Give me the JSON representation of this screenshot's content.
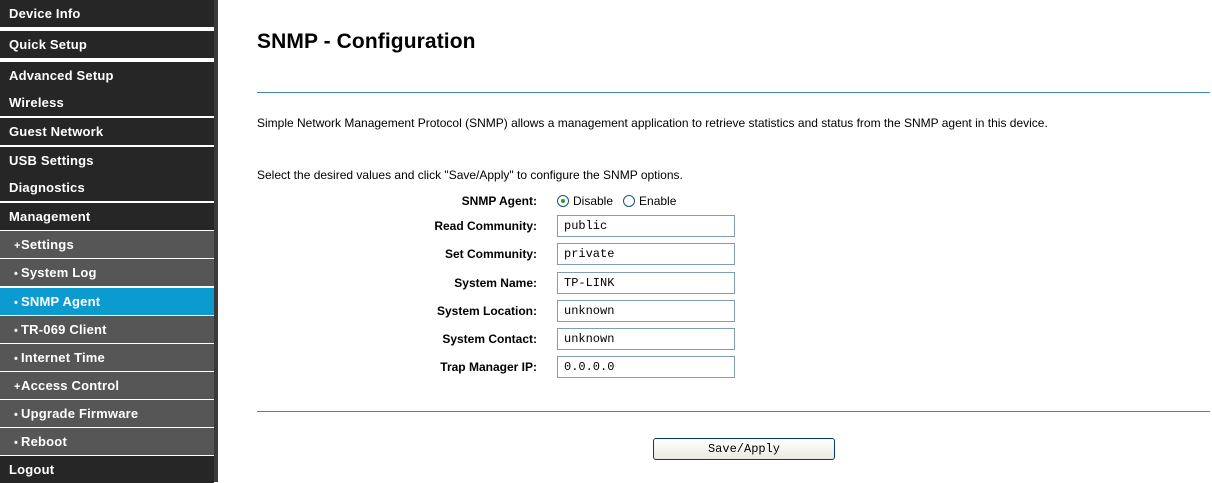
{
  "sidebar": {
    "items": [
      {
        "label": "Device Info",
        "prefix": "",
        "level": "top",
        "active": false
      },
      {
        "label": "Quick Setup",
        "prefix": "",
        "level": "top",
        "active": false
      },
      {
        "label": "Advanced Setup",
        "prefix": "",
        "level": "top",
        "active": false
      },
      {
        "label": "Wireless",
        "prefix": "",
        "level": "top",
        "active": false
      },
      {
        "label": "Guest Network",
        "prefix": "",
        "level": "top",
        "active": false
      },
      {
        "label": "USB Settings",
        "prefix": "",
        "level": "top",
        "active": false
      },
      {
        "label": "Diagnostics",
        "prefix": "",
        "level": "top",
        "active": false
      },
      {
        "label": "Management",
        "prefix": "",
        "level": "top",
        "active": false
      },
      {
        "label": "Settings",
        "prefix": "+",
        "level": "sub",
        "active": false
      },
      {
        "label": "System Log",
        "prefix": "•",
        "level": "sub",
        "active": false
      },
      {
        "label": "SNMP Agent",
        "prefix": "•",
        "level": "sub",
        "active": true
      },
      {
        "label": "TR-069 Client",
        "prefix": "•",
        "level": "sub",
        "active": false
      },
      {
        "label": "Internet Time",
        "prefix": "•",
        "level": "sub",
        "active": false
      },
      {
        "label": "Access Control",
        "prefix": "+",
        "level": "sub",
        "active": false
      },
      {
        "label": "Upgrade Firmware",
        "prefix": "•",
        "level": "sub",
        "active": false
      },
      {
        "label": "Reboot",
        "prefix": "•",
        "level": "sub",
        "active": false
      },
      {
        "label": "Logout",
        "prefix": "",
        "level": "top",
        "active": false
      }
    ]
  },
  "main": {
    "title": "SNMP - Configuration",
    "intro": "Simple Network Management Protocol (SNMP) allows a management application to retrieve statistics and status from the SNMP agent in this device.",
    "instruction": "Select the desired values and click \"Save/Apply\" to configure the SNMP options.",
    "agent": {
      "label": "SNMP Agent:",
      "options": [
        "Disable",
        "Enable"
      ],
      "selected": "Disable"
    },
    "fields": [
      {
        "label": "Read Community:",
        "value": "public"
      },
      {
        "label": "Set Community:",
        "value": "private"
      },
      {
        "label": "System Name:",
        "value": "TP-LINK"
      },
      {
        "label": "System Location:",
        "value": "unknown"
      },
      {
        "label": "System Contact:",
        "value": "unknown"
      },
      {
        "label": "Trap Manager IP:",
        "value": "0.0.0.0"
      }
    ],
    "save_label": "Save/Apply"
  },
  "colors": {
    "nav_top": "#262626",
    "nav_sub": "#565656",
    "nav_active": "#0b9bd1",
    "divider": "#3e89b8"
  },
  "icons": {
    "radio_checked": "radio-checked-icon",
    "radio_unchecked": "radio-unchecked-icon"
  }
}
